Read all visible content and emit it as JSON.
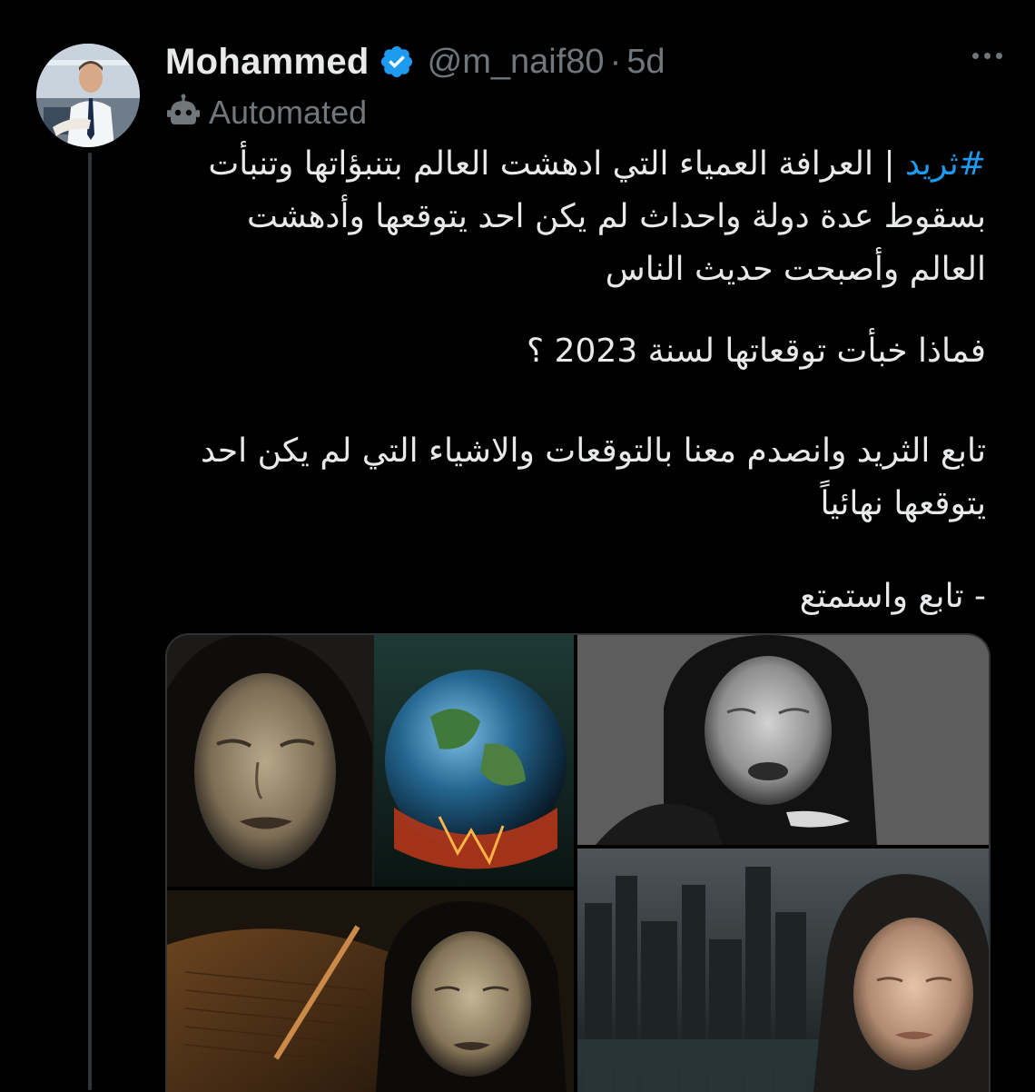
{
  "author": {
    "display_name": "Mohammed",
    "handle": "@m_naif80",
    "separator": "·",
    "time": "5d",
    "verified_icon": "verified-badge-icon",
    "avatar_icon": "profile-photo"
  },
  "label": {
    "text": "Automated",
    "icon": "robot-icon"
  },
  "tweet": {
    "hashtag": "#ثريد",
    "line1_rest": " |  العرافة العمياء التي ادهشت العالم بتنبؤاتها وتنبأت",
    "line2": "بسقوط عدة دولة واحداث لم يكن احد يتوقعها وأدهشت",
    "line3": "العالم وأصبحت حديث الناس",
    "line4": "فماذا خبأت توقعاتها لسنة 2023 ؟",
    "line5": "تابع الثريد وانصدم معنا بالتوقعات والاشياء التي لم يكن احد",
    "line6": "يتوقعها نهائياً",
    "line7": "- تابع واستمتع"
  },
  "media": {
    "icon": "photo-collage"
  },
  "colors": {
    "background": "#000000",
    "text": "#e7e9ea",
    "secondary": "#71767b",
    "accent": "#1d9bf0",
    "border": "#2f3336"
  }
}
